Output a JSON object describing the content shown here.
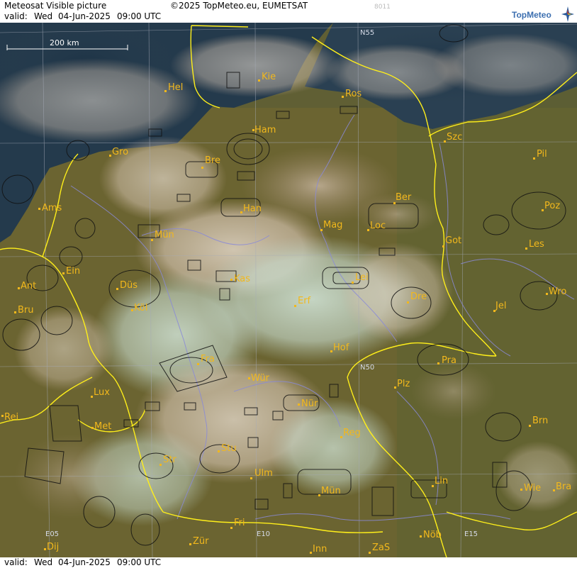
{
  "header": {
    "title": "Meteosat Visible picture",
    "copyright": "©2025 TopMeteo.eu, EUMETSAT",
    "image_code": "8011",
    "valid_label": "valid:",
    "valid_day": "Wed",
    "valid_date": "04-Jun-2025",
    "valid_time": "09:00 UTC"
  },
  "logo": {
    "text": "TopMeteo",
    "icon": "compass-star-icon"
  },
  "scale_bar": {
    "label": "200 km"
  },
  "grid_labels": [
    "N55",
    "N50",
    "E05",
    "E10",
    "E15"
  ],
  "cities": [
    "Hel",
    "Kie",
    "Ros",
    "Ham",
    "Szc",
    "Gro",
    "Bre",
    "Pil",
    "Ams",
    "Han",
    "Ber",
    "Poz",
    "Mün",
    "Mag",
    "Loc",
    "Got",
    "Les",
    "Ein",
    "Düs",
    "Kas",
    "Lei",
    "Ant",
    "Dre",
    "Wro",
    "Bru",
    "Köl",
    "Erf",
    "Jel",
    "Hof",
    "Fra",
    "Pra",
    "Wür",
    "Plz",
    "Lux",
    "Nür",
    "Rei",
    "Met",
    "Reg",
    "Brn",
    "Stu",
    "Str",
    "Ulm",
    "Lin",
    "Mün",
    "Wie",
    "Bra",
    "Fri",
    "Zür",
    "Nöb",
    "Dij",
    "Inn",
    "ZaS"
  ],
  "footer": {
    "valid_label": "valid:",
    "valid_day": "Wed",
    "valid_date": "04-Jun-2025",
    "valid_time": "09:00 UTC"
  },
  "colors": {
    "land": "#6c6430",
    "sea": "#243a4c",
    "cloud": "#e4d6c8",
    "cloud_bright": "#cfe4d8",
    "border": "#ffef1a",
    "river": "#8a8ad8",
    "grid": "#9aa0ad",
    "city": "#f2b81c"
  }
}
